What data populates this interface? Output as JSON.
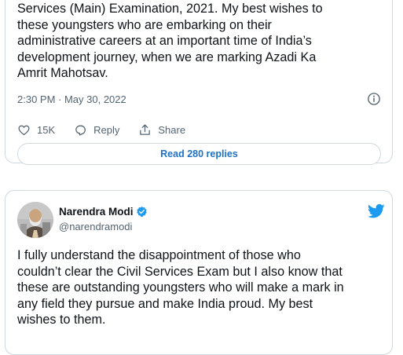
{
  "tweet1": {
    "text": "Services (Main) Examination, 2021. My best wishes to\nthese youngsters who are embarking on their\nadministrative careers at an important time of India’s\ndevelopment journey, when we are marking Azadi Ka\nAmrit Mahotsav.",
    "timestamp": "2:30 PM · May 30, 2022",
    "likes": "15K",
    "reply_label": "Reply",
    "share_label": "Share",
    "read_replies": "Read 280 replies"
  },
  "tweet2": {
    "author_name": "Narendra Modi",
    "author_handle": "@narendramodi",
    "text": "I fully understand the disappointment of those who\ncouldn’t clear the Civil Services Exam but I also know that\nthese are outstanding youngsters who will make a mark in\nany field they pursue and make India proud. My best\nwishes to them."
  },
  "colors": {
    "accent": "#1d9bf0",
    "text_primary": "#0f1419",
    "text_secondary": "#536471",
    "border": "#cfd9de"
  },
  "icons": [
    "info-icon",
    "heart-icon",
    "reply-icon",
    "share-icon",
    "verified-icon",
    "twitter-bird-icon"
  ]
}
